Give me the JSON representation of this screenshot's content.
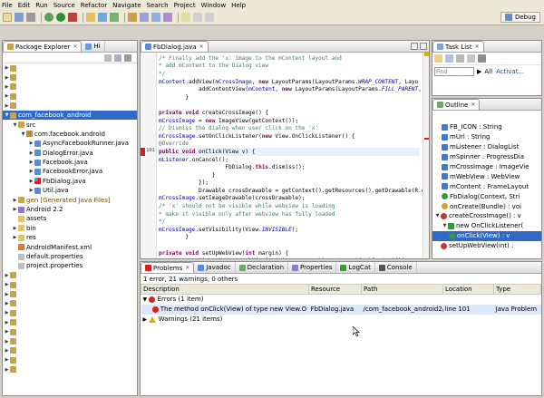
{
  "menu": [
    "File",
    "Edit",
    "Run",
    "Source",
    "Refactor",
    "Navigate",
    "Search",
    "Project",
    "Window",
    "Help"
  ],
  "perspective": {
    "label": "Debug"
  },
  "package_explorer": {
    "tab_label": "Package Explorer",
    "tab2_label": "Hi",
    "items": [
      {
        "label": "",
        "depth": 0,
        "kind": "project",
        "arrow": "▶"
      },
      {
        "label": "",
        "depth": 0,
        "kind": "project",
        "arrow": "▶"
      },
      {
        "label": "",
        "depth": 0,
        "kind": "project",
        "arrow": "▶"
      },
      {
        "label": "",
        "depth": 0,
        "kind": "project",
        "arrow": "▶"
      },
      {
        "label": "",
        "depth": 0,
        "kind": "project",
        "arrow": "▶"
      },
      {
        "label": "com_facebook_android",
        "depth": 0,
        "kind": "project",
        "arrow": "▼",
        "selected": true
      },
      {
        "label": "src",
        "depth": 1,
        "kind": "src",
        "arrow": "▼"
      },
      {
        "label": "com.facebook.android",
        "depth": 2,
        "kind": "package",
        "arrow": "▼"
      },
      {
        "label": "AsyncFacebookRunner.java",
        "depth": 3,
        "kind": "java",
        "arrow": "▶"
      },
      {
        "label": "DialogError.java",
        "depth": 3,
        "kind": "java",
        "arrow": "▶"
      },
      {
        "label": "Facebook.java",
        "depth": 3,
        "kind": "java",
        "arrow": "▶"
      },
      {
        "label": "FacebookError.java",
        "depth": 3,
        "kind": "java",
        "arrow": "▶"
      },
      {
        "label": "FbDialog.java",
        "depth": 3,
        "kind": "java-err",
        "arrow": "▶"
      },
      {
        "label": "Util.java",
        "depth": 3,
        "kind": "java",
        "arrow": "▶"
      },
      {
        "label": "gen [Generated Java Files]",
        "depth": 1,
        "kind": "gen",
        "arrow": "▶"
      },
      {
        "label": "Android 2.2",
        "depth": 1,
        "kind": "lib",
        "arrow": "▶"
      },
      {
        "label": "assets",
        "depth": 1,
        "kind": "folder",
        "arrow": ""
      },
      {
        "label": "bin",
        "depth": 1,
        "kind": "folder",
        "arrow": "▶"
      },
      {
        "label": "res",
        "depth": 1,
        "kind": "folder",
        "arrow": "▶"
      },
      {
        "label": "AndroidManifest.xml",
        "depth": 1,
        "kind": "xml",
        "arrow": ""
      },
      {
        "label": "default.properties",
        "depth": 1,
        "kind": "file",
        "arrow": ""
      },
      {
        "label": "project.properties",
        "depth": 1,
        "kind": "file",
        "arrow": ""
      },
      {
        "label": "",
        "depth": 0,
        "kind": "project",
        "arrow": "▶"
      },
      {
        "label": "",
        "depth": 0,
        "kind": "project",
        "arrow": "▶"
      },
      {
        "label": "",
        "depth": 0,
        "kind": "project",
        "arrow": "▶"
      },
      {
        "label": "",
        "depth": 0,
        "kind": "project",
        "arrow": "▶"
      },
      {
        "label": "",
        "depth": 0,
        "kind": "project",
        "arrow": "▶"
      },
      {
        "label": "",
        "depth": 0,
        "kind": "project",
        "arrow": "▶"
      },
      {
        "label": "",
        "depth": 0,
        "kind": "project",
        "arrow": "▶"
      },
      {
        "label": "",
        "depth": 0,
        "kind": "project",
        "arrow": "▶"
      },
      {
        "label": "",
        "depth": 0,
        "kind": "project",
        "arrow": "▶"
      },
      {
        "label": "",
        "depth": 0,
        "kind": "project",
        "arrow": "▶"
      },
      {
        "label": "",
        "depth": 0,
        "kind": "project",
        "arrow": "▶"
      }
    ]
  },
  "editor": {
    "tab_label": "FbDialog.java",
    "lines": [
      {
        "n": "",
        "html": "            <span class=\"cm\">/* Finally add the 'x' image to the mContent layout and</span>"
      },
      {
        "n": "",
        "html": "             <span class=\"cm\">* add mContent to the Dialog view</span>"
      },
      {
        "n": "",
        "html": "             <span class=\"cm\">*/</span>"
      },
      {
        "n": "",
        "html": "            <span class=\"fd\">mContent</span>.addView(<span class=\"fd\">mCrossImage</span>, <span class=\"kw\">new</span> LayoutParams(LayoutParams.<span class=\"st\">WRAP_CONTENT</span>, Layo"
      },
      {
        "n": "",
        "html": "            addContentView(<span class=\"fd\">mContent</span>, <span class=\"kw\">new</span> LayoutParams(LayoutParams.<span class=\"st\">FILL_PARENT</span>, LayoutPar"
      },
      {
        "n": "",
        "html": "        }"
      },
      {
        "n": "",
        "html": " "
      },
      {
        "n": "",
        "html": "        <span class=\"kw\">private void</span> createCrossImage() {"
      },
      {
        "n": "",
        "html": "            <span class=\"fd\">mCrossImage</span> = <span class=\"kw\">new</span> ImageView(getContext());"
      },
      {
        "n": "",
        "html": "            <span class=\"cm\">// Dismiss the dialog when user click on the 'x'</span>"
      },
      {
        "n": "",
        "html": "            <span class=\"fd\">mCrossImage</span>.setOnClickListener(<span class=\"kw\">new</span> View.OnClickListener() {"
      },
      {
        "n": "",
        "html": "                <span class=\"an\">@Override</span>"
      },
      {
        "n": "101",
        "html": "                <span class=\"kw\">public void</span> onClick(View v) {",
        "hl": true,
        "err": true
      },
      {
        "n": "",
        "html": "                    <span class=\"fd\">mListener</span>.onCancel();"
      },
      {
        "n": "",
        "html": "                    FbDialog.<span class=\"kw\">this</span>.dismiss();"
      },
      {
        "n": "",
        "html": "                }"
      },
      {
        "n": "",
        "html": "            });"
      },
      {
        "n": "",
        "html": "            Drawable crossDrawable = getContext().getResources().getDrawable(R.drawable.<span class=\"st\">cl</span>"
      },
      {
        "n": "",
        "html": "            <span class=\"fd\">mCrossImage</span>.setImageDrawable(crossDrawable);"
      },
      {
        "n": "",
        "html": "            <span class=\"cm\">/* 'x' should not be visible while webview is loading</span>"
      },
      {
        "n": "",
        "html": "             <span class=\"cm\">* make it visible only after webview has fully loaded</span>"
      },
      {
        "n": "",
        "html": "             <span class=\"cm\">*/</span>"
      },
      {
        "n": "",
        "html": "            <span class=\"fd\">mCrossImage</span>.setVisibility(View.<span class=\"st\">INVISIBLE</span>);"
      },
      {
        "n": "",
        "html": "        }"
      },
      {
        "n": "",
        "html": " "
      },
      {
        "n": "",
        "html": "        <span class=\"kw\">private void</span> setUpWebView(<span class=\"kw\">int</span> margin) {"
      },
      {
        "n": "",
        "html": "            LinearLayout webViewContainer = <span class=\"kw\">new</span> LinearLayout(getContext());"
      }
    ]
  },
  "task_list": {
    "tab_label": "Task List",
    "find_placeholder": "Find",
    "all_label": "All",
    "activate_label": "Activat..."
  },
  "outline": {
    "tab_label": "Outline",
    "items": [
      {
        "label": "FB_ICON : String",
        "depth": 1,
        "kind": "field-final"
      },
      {
        "label": "mUrl : String",
        "depth": 1,
        "kind": "field"
      },
      {
        "label": "mListener : DialogList",
        "depth": 1,
        "kind": "field"
      },
      {
        "label": "mSpinner : ProgressDia",
        "depth": 1,
        "kind": "field"
      },
      {
        "label": "mCrossImage : ImageVie",
        "depth": 1,
        "kind": "field"
      },
      {
        "label": "mWebView : WebView",
        "depth": 1,
        "kind": "field"
      },
      {
        "label": "mContent : FrameLayout",
        "depth": 1,
        "kind": "field"
      },
      {
        "label": "FbDialog(Context, Stri",
        "depth": 1,
        "kind": "ctor"
      },
      {
        "label": "onCreate(Bundle) : voi",
        "depth": 1,
        "kind": "method-prot"
      },
      {
        "label": "createCrossImage() : v",
        "depth": 0,
        "kind": "method-priv",
        "arrow": "▼"
      },
      {
        "label": "new OnClickListener(",
        "depth": 1,
        "kind": "class",
        "arrow": "▼"
      },
      {
        "label": "onClick(View) : v",
        "depth": 2,
        "kind": "method",
        "selected": true
      },
      {
        "label": "setUpWebView(int) : ",
        "depth": 0,
        "kind": "method-priv",
        "arrow": ""
      }
    ]
  },
  "problems": {
    "tabs": [
      "Problems",
      "Javadoc",
      "Declaration",
      "Properties",
      "LogCat",
      "Console"
    ],
    "summary": "1 error, 21 warnings, 0 others",
    "columns": [
      "Description",
      "Resource",
      "Path",
      "Location",
      "Type"
    ],
    "errors_group": "Errors (1 item)",
    "error_row": {
      "description": "The method onClick(View) of type new View.O",
      "resource": "FbDialog.java",
      "path": "/com_facebook_android2/",
      "location": "line 101",
      "type": "Java Problem"
    },
    "warnings_group": "Warnings (21 items)"
  },
  "colors": {
    "selection": "#316ac5",
    "error": "#d42020",
    "warning": "#e0b000"
  }
}
